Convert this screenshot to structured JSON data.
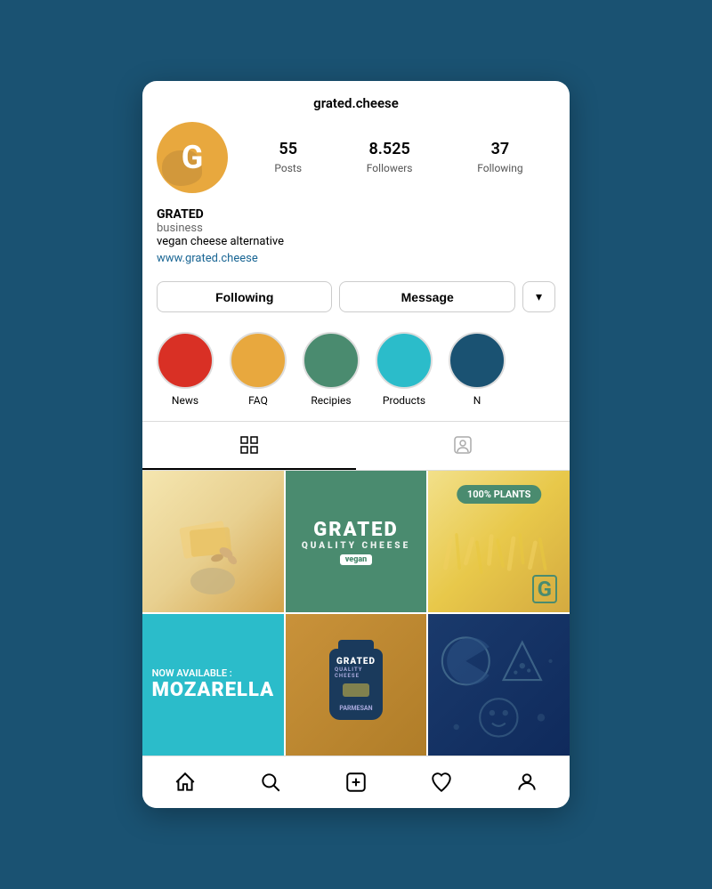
{
  "app": {
    "title": "grated.cheese"
  },
  "profile": {
    "username": "grated.cheese",
    "avatar_letter": "G",
    "stats": {
      "posts_count": "55",
      "posts_label": "Posts",
      "followers_count": "8.525",
      "followers_label": "Followers",
      "following_count": "37",
      "following_label": "Following"
    },
    "bio": {
      "name": "GRATED",
      "category": "business",
      "description": "vegan cheese alternative",
      "website": "www.grated.cheese"
    },
    "buttons": {
      "following": "Following",
      "message": "Message",
      "dropdown": "▾"
    }
  },
  "highlights": [
    {
      "id": "news",
      "label": "News",
      "color": "#d93025"
    },
    {
      "id": "faq",
      "label": "FAQ",
      "color": "#e8a83e"
    },
    {
      "id": "recipies",
      "label": "Recipies",
      "color": "#4a8b6f"
    },
    {
      "id": "products",
      "label": "Products",
      "color": "#2bbcca"
    },
    {
      "id": "more",
      "label": "N",
      "color": "#1a5272"
    }
  ],
  "grid": {
    "items": [
      {
        "id": "cashews",
        "type": "food-photo"
      },
      {
        "id": "brand-green",
        "type": "brand",
        "text1": "GRATED",
        "text2": "QUALITY CHEESE",
        "text3": "vegan"
      },
      {
        "id": "shredded",
        "type": "plants",
        "badge": "100% PLANTS"
      },
      {
        "id": "mozarella",
        "type": "announcement",
        "text1": "NOW AVAILABLE :",
        "text2": "MOZARELLA"
      },
      {
        "id": "product-bag",
        "type": "product",
        "brand": "GRATED",
        "sub": "QUALITY CHEESE",
        "bottom": "PARMESAN"
      },
      {
        "id": "doodle",
        "type": "art"
      }
    ]
  },
  "bottom_nav": {
    "items": [
      "home",
      "search",
      "add",
      "heart",
      "profile"
    ]
  }
}
